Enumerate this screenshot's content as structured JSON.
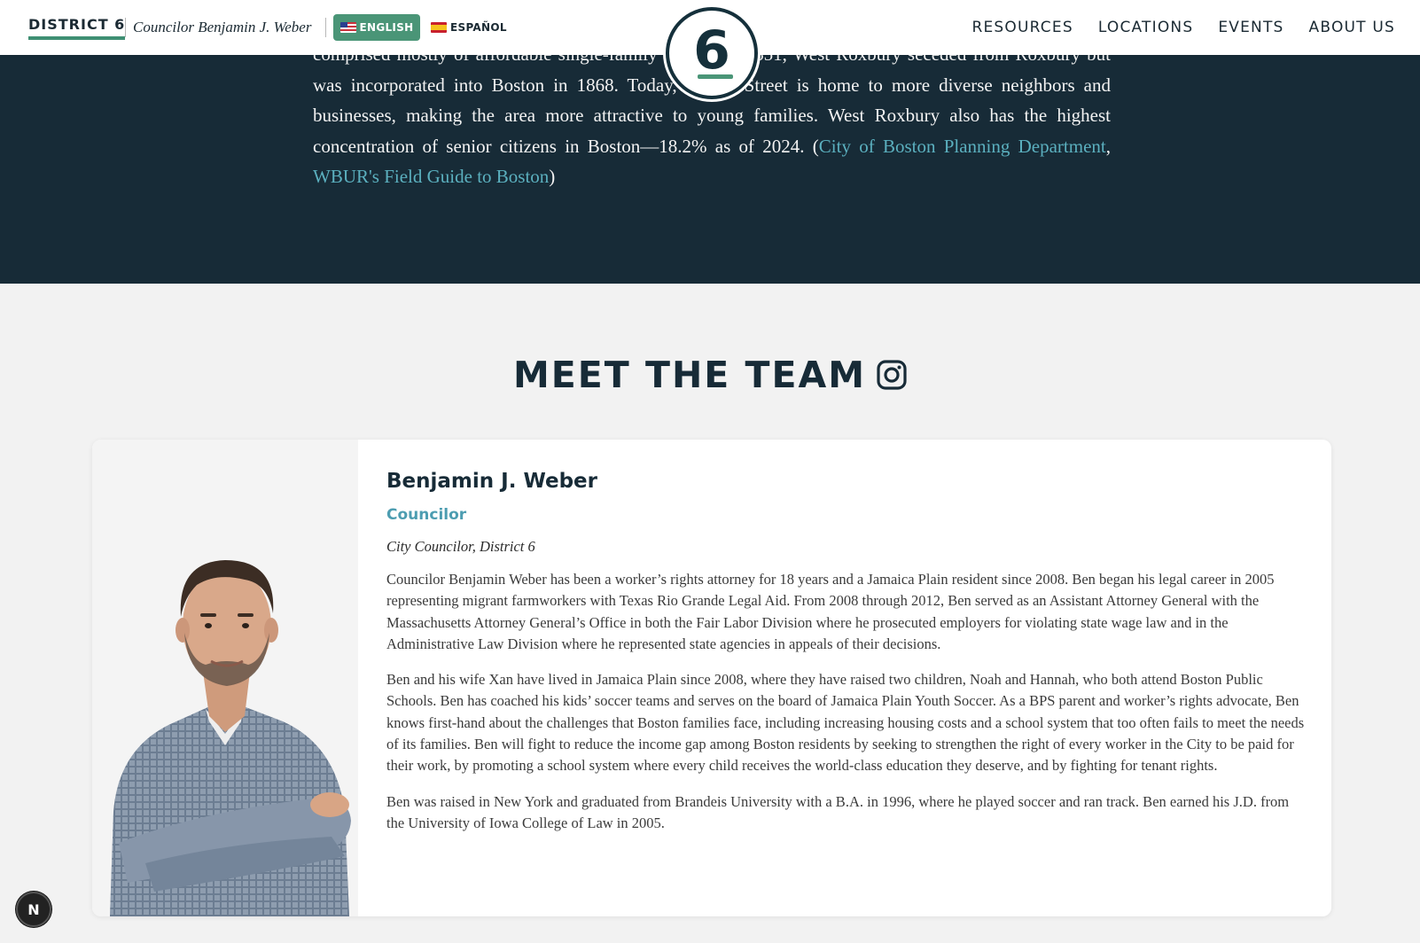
{
  "nav": {
    "brand": "DISTRICT 6",
    "councilor": "Councilor Benjamin J. Weber",
    "lang_english": "ENGLISH",
    "lang_spanish": "ESPAÑOL",
    "links": [
      "RESOURCES",
      "LOCATIONS",
      "EVENTS",
      "ABOUT US"
    ],
    "logo_digit": "6"
  },
  "history": {
    "line1": "comprised mostly of affordable single-family homes. In 1851, West Roxbury seceded from Roxbury",
    "body": " but was incorporated into Boston in 1868. Today, Centre Street is home to more diverse neighbors and businesses, making the area more attractive to young families. West Roxbury also has the highest concentration of senior citizens in Boston—18.2% as of 2024. (",
    "link1": "City of Boston Planning Department",
    "sep": ", ",
    "link2": "WBUR's Field Guide to Boston",
    "close": ")"
  },
  "team": {
    "title": "MEET THE TEAM",
    "member": {
      "name": "Benjamin J. Weber",
      "role": "Councilor",
      "subtitle": "City Councilor, District 6",
      "bio": [
        "Councilor Benjamin Weber has been a worker’s rights attorney for 18 years and a Jamaica Plain resident since 2008. Ben began his legal career in 2005 representing migrant farmworkers with Texas Rio Grande Legal Aid. From 2008 through 2012, Ben served as an Assistant Attorney General with the Massachusetts Attorney General’s Office in both the Fair Labor Division where he prosecuted employers for violating state wage law and in the Administrative Law Division where he represented state agencies in appeals of their decisions.",
        "Ben and his wife Xan have lived in Jamaica Plain since 2008, where they have raised two children, Noah and Hannah, who both attend Boston Public Schools. Ben has coached his kids’ soccer teams and serves on the board of Jamaica Plain Youth Soccer. As a BPS parent and worker’s rights advocate, Ben knows first-hand about the challenges that Boston families face, including increasing housing costs and a school system that too often fails to meet the needs of its families. Ben will fight to reduce the income gap among Boston residents by seeking to strengthen the right of every worker in the City to be paid for their work, by promoting a school system where every child receives the world-class education they deserve, and by fighting for tenant rights.",
        "Ben was raised in New York and graduated from Brandeis University with a B.A. in 1996, where he played soccer and ran track. Ben earned his J.D. from the University of Iowa College of Law in 2005."
      ]
    }
  },
  "dev_badge": "N",
  "colors": {
    "accent_green": "#4a9577",
    "dark_navy": "#172b37",
    "link_teal": "#5bb0bf",
    "role_blue": "#4d9db1"
  }
}
